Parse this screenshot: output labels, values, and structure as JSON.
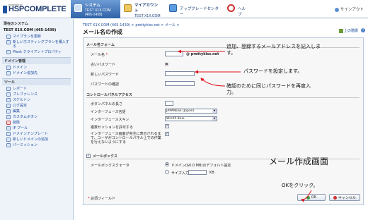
{
  "logo": {
    "text": "HSPCOMPLETE",
    "sub": "POWERED BY"
  },
  "tabs": [
    {
      "title": "システム",
      "sub": "TEST X1X.COM (465-1439)"
    },
    {
      "title": "マイアカウント",
      "sub": "TEST X1X.COM"
    },
    {
      "title": "アップグレードセンター"
    },
    {
      "title": "ヘルプ"
    }
  ],
  "logout": "サインアウト",
  "sidebar": {
    "header": "現在のシステム",
    "domain": "TEST X1X.COM (465-1439)",
    "top_items": [
      "マイプランを更新",
      "新しいホスティングプランを購入する",
      "Plesk クライアントプロパティ"
    ],
    "domain_section": "ドメイン管理",
    "domain_items": [
      "ドメイン",
      "ドメイン追加先"
    ],
    "tools_section": "ツール",
    "tool_items": [
      "レポート",
      "プレファレンス",
      "スケルトン",
      "ログ設定",
      "編集",
      "カスタムボタン",
      "削除",
      "IP プール",
      "ドメインテンプレート",
      "新しいドメインの追加",
      "パーミッション"
    ]
  },
  "main": {
    "breadcrumb": "TEST X1X.COM (465-1439) > prettykiss.net > メール >",
    "title": "メール名の作成",
    "up_level": "上の階層",
    "mail_form_section": "メール名フォーム",
    "mail_name_label": "メール名",
    "mail_name_value": "",
    "mail_domain": "@ prettykiss.net",
    "old_password_label": "古いパスワード",
    "old_password_value": "無",
    "new_password_label": "新しいパスワード",
    "confirm_password_label": "パスワードの確認",
    "cp_section": "コントロールパネルアクセス",
    "button_panel_label": "ボタンパネルの長さ",
    "language_label": "インターフェース言語",
    "language_value": "JAPANESE (Japan)",
    "skin_label": "インターフェーススキン",
    "skin_value": "WinXP Blue",
    "multi_session_label": "複数セッションを許可する",
    "prevent_label": "インターフェース画面が完全に表示されるまで、ユーザがコントロールパネル上での作業を行えないようにする",
    "mailbox_section": "メールボックス",
    "quota_label": "メールボックスクォータ",
    "quota_default": "ドメイン($0.0 MB)のデフォルト設定",
    "quota_size": "サイズ入力",
    "quota_unit": "KB",
    "required_note": "必須フィールド",
    "ok_label": "OK",
    "cancel_label": "キャンセル"
  },
  "annotations": {
    "a1": "追加、登録するメールアドレスを記入します。",
    "a2": "パスワードを設定します。",
    "a3": "確認のために同じパスワードを再度入力。",
    "a4": "メール作成画面",
    "a5": "OKをクリック。"
  },
  "colors": {
    "accent": "#2f62a8",
    "annotation_arrow": "#e0101e"
  }
}
